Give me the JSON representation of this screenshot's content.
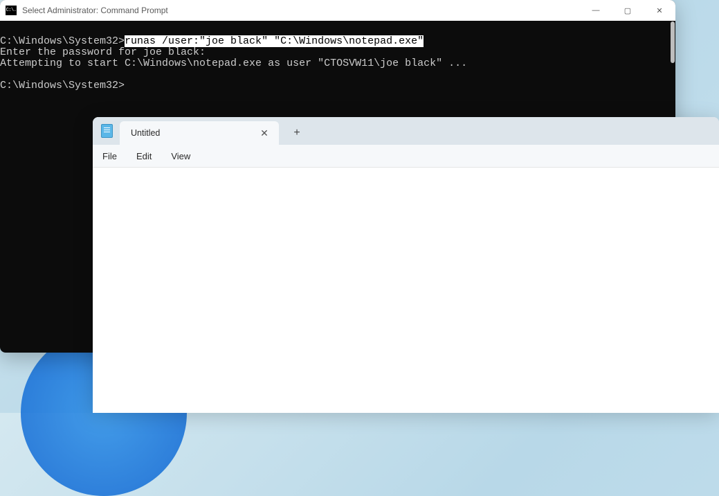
{
  "cmd": {
    "title": "Select Administrator: Command Prompt",
    "icon_text": "C:\\.",
    "lines": {
      "l1_prompt": "C:\\Windows\\System32>",
      "l1_cmd": "runas /user:\"joe black\" \"C:\\Windows\\notepad.exe\"",
      "l2": "Enter the password for joe black:",
      "l3": "Attempting to start C:\\Windows\\notepad.exe as user \"CTOSVW11\\joe black\" ...",
      "l4": "",
      "l5": "C:\\Windows\\System32>"
    },
    "controls": {
      "min": "—",
      "max": "▢",
      "close": "✕"
    }
  },
  "notepad": {
    "tab_label": "Untitled",
    "tab_close": "✕",
    "new_tab": "+",
    "menu": {
      "file": "File",
      "edit": "Edit",
      "view": "View"
    }
  }
}
